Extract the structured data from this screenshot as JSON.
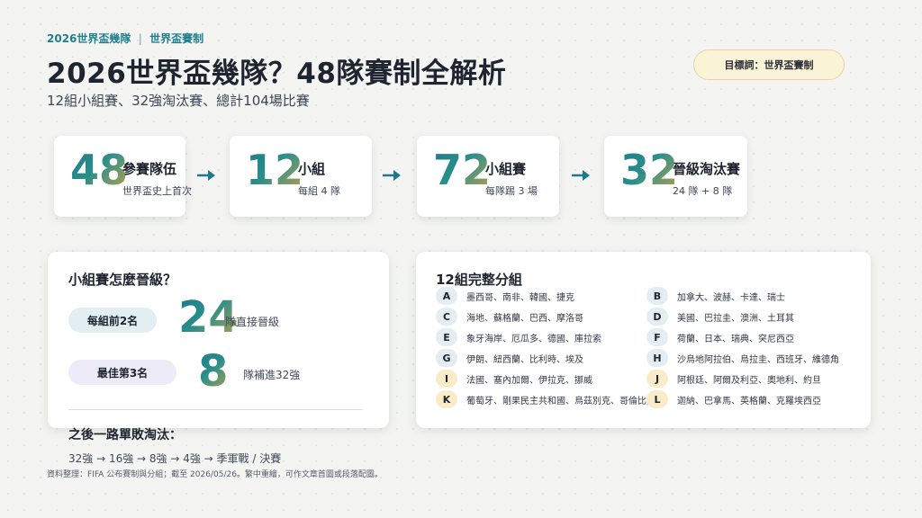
{
  "header": {
    "kicker_left": "2026世界盃幾隊",
    "kicker_sep": "|",
    "kicker_right": "世界盃賽制",
    "title": "2026世界盃幾隊？48隊賽制全解析",
    "subtitle": "12組小組賽、32強淘汰賽、總計104場比賽",
    "keyword": "目標詞：世界盃賽制"
  },
  "stats": [
    {
      "number": "48",
      "label": "參賽隊伍",
      "sub": "世界盃史上首次"
    },
    {
      "number": "12",
      "label": "小組",
      "sub": "每組 4 隊"
    },
    {
      "number": "72",
      "label": "小組賽",
      "sub": "每隊踢 3 場"
    },
    {
      "number": "32",
      "label": "晉級淘汰賽",
      "sub": "24 隊 + 8 隊"
    }
  ],
  "advance": {
    "title": "小組賽怎麼晉級？",
    "rows": [
      {
        "pill": "每組前2名",
        "number": "24",
        "desc": "隊直接晉級"
      },
      {
        "pill": "最佳第3名",
        "number": "8",
        "desc": "隊補進32強"
      }
    ],
    "after_title": "之後一路單敗淘汰：",
    "after_path": "32強 → 16強 → 8強 → 4強 → 季軍戰 / 決賽"
  },
  "groups": {
    "title": "12組完整分組",
    "list": [
      {
        "letter": "A",
        "teams": "墨西哥、南非、韓國、捷克"
      },
      {
        "letter": "B",
        "teams": "加拿大、波赫、卡達、瑞士"
      },
      {
        "letter": "C",
        "teams": "海地、蘇格蘭、巴西、摩洛哥"
      },
      {
        "letter": "D",
        "teams": "美國、巴拉圭、澳洲、土耳其"
      },
      {
        "letter": "E",
        "teams": "象牙海岸、厄瓜多、德國、庫拉索"
      },
      {
        "letter": "F",
        "teams": "荷蘭、日本、瑞典、突尼西亞"
      },
      {
        "letter": "G",
        "teams": "伊朗、紐西蘭、比利時、埃及"
      },
      {
        "letter": "H",
        "teams": "沙烏地阿拉伯、烏拉圭、西班牙、維德角"
      },
      {
        "letter": "I",
        "teams": "法國、塞內加爾、伊拉克、挪威"
      },
      {
        "letter": "J",
        "teams": "阿根廷、阿爾及利亞、奧地利、約旦"
      },
      {
        "letter": "K",
        "teams": "葡萄牙、剛果民主共和國、烏茲別克、哥倫比亞"
      },
      {
        "letter": "L",
        "teams": "迦納、巴拿馬、英格蘭、克羅埃西亞"
      }
    ]
  },
  "footer": {
    "source": "資料整理：FIFA 公布賽制與分組；截至 2026/05/26。繁中重繪，可作文章首圖或段落配圖。"
  },
  "colors": {
    "accent_teal": "#1d7a8c",
    "accent_gold": "#b9a24a",
    "badge_blue": "#e4eef2",
    "badge_yellow": "#fbecc9"
  }
}
